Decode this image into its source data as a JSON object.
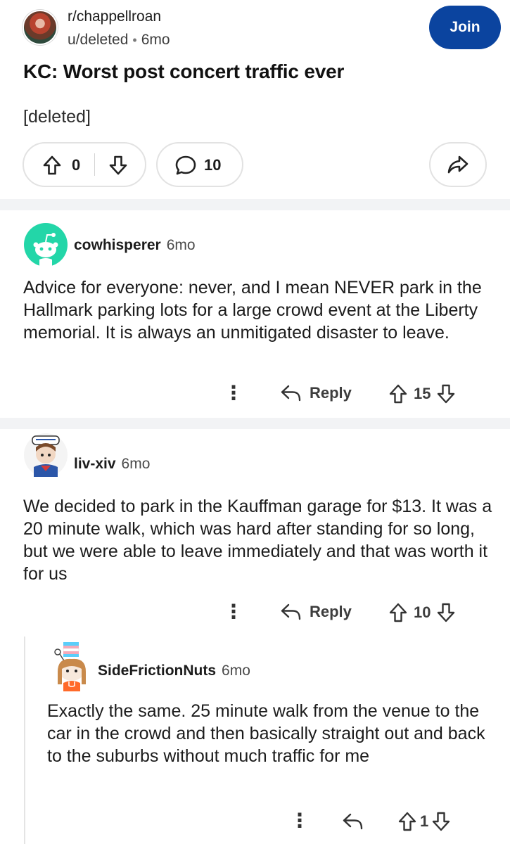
{
  "post": {
    "subreddit": "r/chappellroan",
    "author": "u/deleted",
    "age": "6mo",
    "join_label": "Join",
    "title": "KC: Worst post concert traffic ever",
    "body": "[deleted]",
    "score": "0",
    "comment_count": "10"
  },
  "comments": [
    {
      "author": "cowhisperer",
      "age": "6mo",
      "text": "Advice for everyone: never, and I mean NEVER park in the Hallmark parking lots for a large crowd event at the Liberty memorial. It is always an unmitigated disaster to leave.",
      "reply_label": "Reply",
      "score": "15"
    },
    {
      "author": "liv-xiv",
      "age": "6mo",
      "text": "We decided to park in the Kauffman garage for $13. It was a 20 minute walk, which was hard after standing for so long, but we were able to leave immediately and that was worth it for us",
      "reply_label": "Reply",
      "score": "10"
    },
    {
      "author": "SideFrictionNuts",
      "age": "6mo",
      "text": "Exactly the same. 25 minute walk from the venue to the car in the crowd and then basically straight out and back to the suburbs without much traffic for me",
      "score": "1"
    }
  ],
  "icons": {
    "upvote": "upvote-arrow-icon",
    "downvote": "downvote-arrow-icon",
    "comment": "speech-bubble-icon",
    "share": "share-arrow-icon",
    "reply": "reply-arrow-icon",
    "more": "vertical-dots-icon"
  },
  "colors": {
    "join_button": "#0b449f",
    "divider": "#f2f3f5",
    "snoo_teal": "#23d6a8"
  }
}
